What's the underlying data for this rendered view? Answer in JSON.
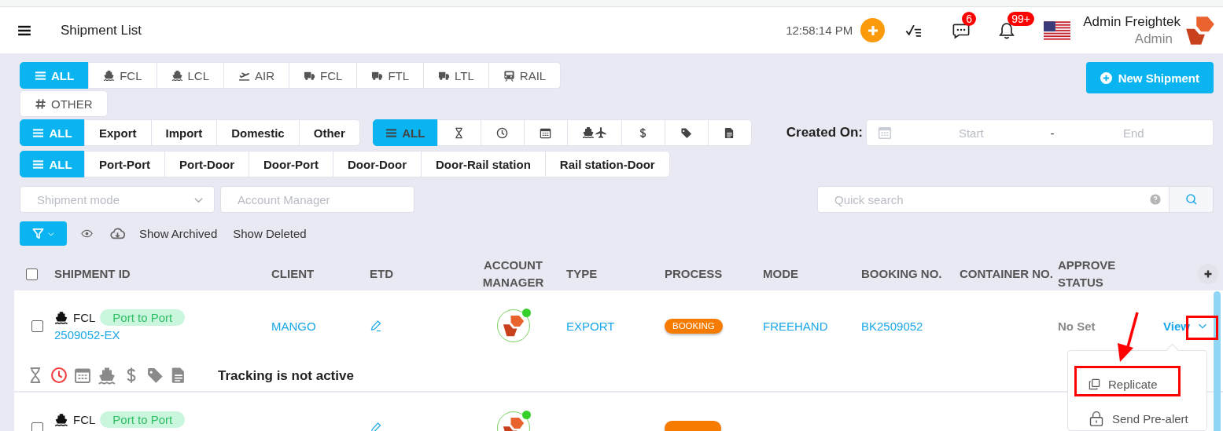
{
  "header": {
    "title": "Shipment List",
    "time": "12:58:14 PM",
    "messages_badge": "6",
    "notifications_badge": "99+",
    "user_name": "Admin Freightek",
    "user_role": "Admin"
  },
  "mode_tabs": [
    {
      "label": "ALL",
      "kind": "all",
      "selected": true
    },
    {
      "label": "FCL",
      "kind": "sea",
      "selected": false
    },
    {
      "label": "LCL",
      "kind": "sea",
      "selected": false
    },
    {
      "label": "AIR",
      "kind": "air",
      "selected": false
    },
    {
      "label": "FCL",
      "kind": "road",
      "selected": false
    },
    {
      "label": "FTL",
      "kind": "road",
      "selected": false
    },
    {
      "label": "LTL",
      "kind": "road",
      "selected": false
    },
    {
      "label": "RAIL",
      "kind": "rail",
      "selected": false
    },
    {
      "label": "OTHER",
      "kind": "other",
      "selected": false
    }
  ],
  "new_shipment_button": "New Shipment",
  "direction_tabs": [
    {
      "label": "ALL",
      "kind": "all",
      "selected": true
    },
    {
      "label": "Export",
      "kind": "option",
      "selected": false
    },
    {
      "label": "Import",
      "kind": "option",
      "selected": false
    },
    {
      "label": "Domestic",
      "kind": "option",
      "selected": false
    },
    {
      "label": "Other",
      "kind": "option",
      "selected": false
    }
  ],
  "stage_tabs": [
    {
      "label": "ALL",
      "kind": "all",
      "selected": true
    },
    {
      "kind": "pending",
      "selected": false
    },
    {
      "kind": "time",
      "selected": false
    },
    {
      "kind": "schedule",
      "selected": false
    },
    {
      "kind": "transport",
      "selected": false
    },
    {
      "kind": "finance",
      "selected": false
    },
    {
      "kind": "tags",
      "selected": false
    },
    {
      "kind": "documents",
      "selected": false
    }
  ],
  "created_on": {
    "label": "Created On:",
    "start_placeholder": "Start",
    "separator": "-",
    "end_placeholder": "End"
  },
  "route_tabs": [
    {
      "label": "ALL",
      "kind": "all",
      "selected": true
    },
    {
      "label": "Port-Port",
      "kind": "option",
      "selected": false
    },
    {
      "label": "Port-Door",
      "kind": "option",
      "selected": false
    },
    {
      "label": "Door-Port",
      "kind": "option",
      "selected": false
    },
    {
      "label": "Door-Door",
      "kind": "option",
      "selected": false
    },
    {
      "label": "Door-Rail station",
      "kind": "option",
      "selected": false
    },
    {
      "label": "Rail station-Door",
      "kind": "option",
      "selected": false
    }
  ],
  "shipment_mode_select": {
    "placeholder": "Shipment mode"
  },
  "account_manager_field": {
    "placeholder": "Account Manager"
  },
  "quick_search": {
    "placeholder": "Quick search"
  },
  "toolbar": {
    "show_archived": "Show Archived",
    "show_deleted": "Show Deleted"
  },
  "table": {
    "select_all_checked": false,
    "columns": [
      "SHIPMENT ID",
      "CLIENT",
      "ETD",
      "ACCOUNT MANAGER",
      "TYPE",
      "PROCESS",
      "MODE",
      "BOOKING NO.",
      "CONTAINER NO.",
      "APPROVE STATUS"
    ],
    "rows": [
      {
        "checked": false,
        "kind": "sea",
        "mode": "FCL",
        "route": "Port to Port",
        "shipment_id": "2509052-EX",
        "client": "MANGO",
        "manager_online": true,
        "type": "EXPORT",
        "process": "BOOKING",
        "transport_mode": "FREEHAND",
        "booking_no": "BK2509052",
        "approve_status": "No Set",
        "action": "View",
        "milestones": [
          {
            "kind": "pending",
            "alert": false
          },
          {
            "kind": "time",
            "alert": true
          },
          {
            "kind": "schedule",
            "alert": false
          },
          {
            "kind": "sea",
            "alert": false
          },
          {
            "kind": "finance",
            "alert": false
          },
          {
            "kind": "tags",
            "alert": false
          },
          {
            "kind": "documents",
            "alert": false
          }
        ],
        "tracking": "Tracking is not active"
      },
      {
        "checked": false,
        "kind": "sea",
        "mode": "FCL",
        "route": "Port to Port",
        "manager_online": true
      }
    ]
  },
  "row_menu": {
    "items": [
      {
        "label": "Replicate",
        "kind": "copy"
      },
      {
        "label": "Send Pre-alert",
        "kind": "lock"
      }
    ]
  }
}
